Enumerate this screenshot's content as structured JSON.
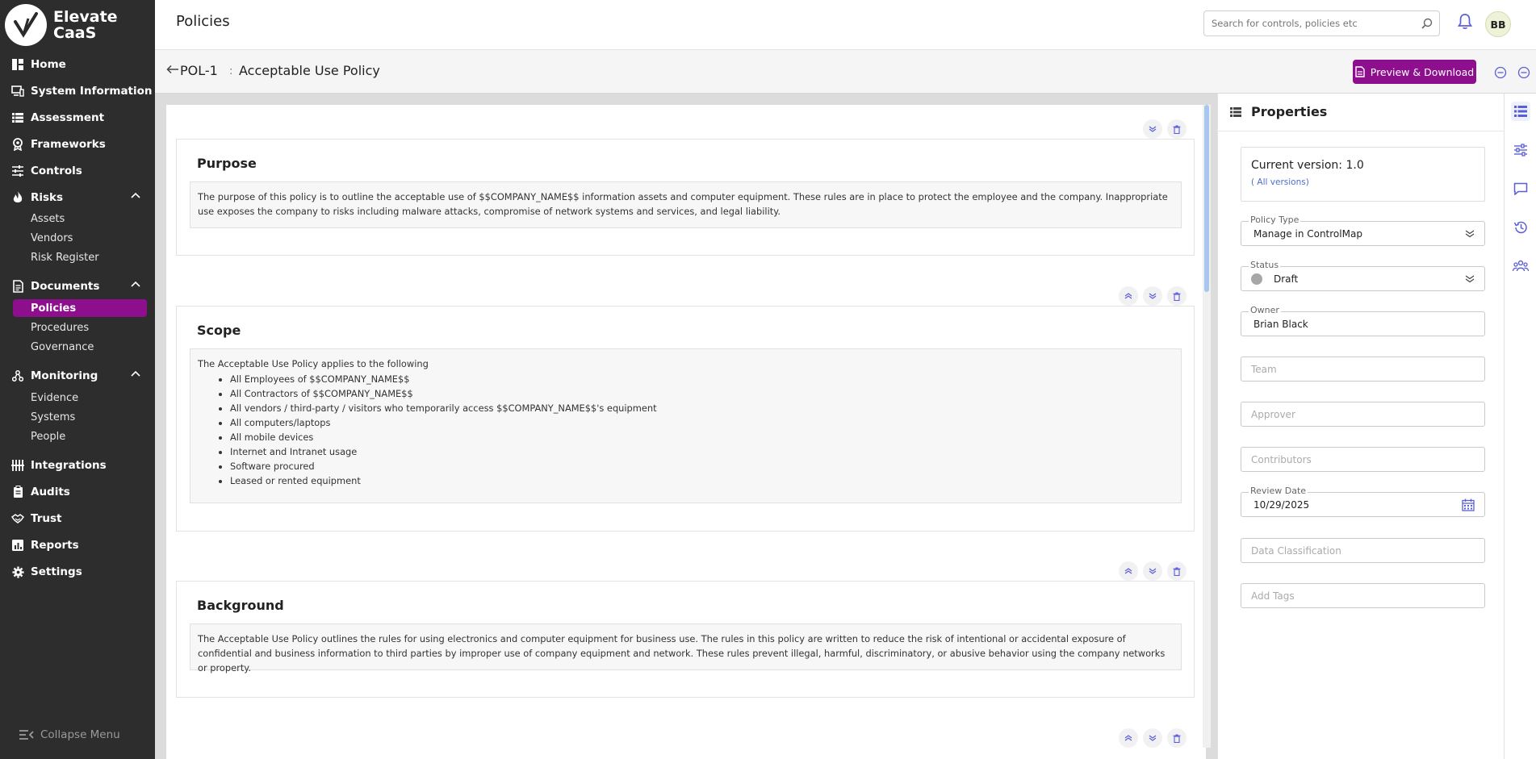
{
  "brand": {
    "line1": "Elevate",
    "line2": "CaaS"
  },
  "sidebar": {
    "items": [
      {
        "label": "Home",
        "icon": "dashboard-icon"
      },
      {
        "label": "System Information",
        "icon": "monitor-icon"
      },
      {
        "label": "Assessment",
        "icon": "list-icon"
      },
      {
        "label": "Frameworks",
        "icon": "badge-icon"
      },
      {
        "label": "Controls",
        "icon": "sliders-icon"
      },
      {
        "label": "Risks",
        "icon": "flame-icon",
        "expanded": true,
        "children": [
          "Assets",
          "Vendors",
          "Risk Register"
        ]
      },
      {
        "label": "Documents",
        "icon": "document-icon",
        "expanded": true,
        "children": [
          "Policies",
          "Procedures",
          "Governance"
        ],
        "active_child": "Policies"
      },
      {
        "label": "Monitoring",
        "icon": "nodes-icon",
        "expanded": true,
        "children": [
          "Evidence",
          "Systems",
          "People"
        ]
      },
      {
        "label": "Integrations",
        "icon": "integrations-icon"
      },
      {
        "label": "Audits",
        "icon": "clipboard-icon"
      },
      {
        "label": "Trust",
        "icon": "handshake-icon"
      },
      {
        "label": "Reports",
        "icon": "report-icon"
      },
      {
        "label": "Settings",
        "icon": "gear-icon"
      }
    ],
    "collapse_label": "Collapse Menu"
  },
  "topbar": {
    "title": "Policies",
    "search_placeholder": "Search for controls, policies etc",
    "avatar_initials": "BB"
  },
  "policy": {
    "id": "POL-1",
    "separator": ":",
    "name": "Acceptable Use Policy",
    "preview_label": "Preview & Download"
  },
  "sections": [
    {
      "title": "Purpose",
      "body": "The purpose of this policy is to outline the acceptable use of $$COMPANY_NAME$$ information assets and computer equipment. These rules are in place to protect the employee and the company. Inappropriate use exposes the company to risks including malware attacks, compromise of network systems and services, and legal liability."
    },
    {
      "title": "Scope",
      "intro": "The Acceptable Use Policy applies to the following",
      "bullets": [
        "All Employees of $$COMPANY_NAME$$",
        "All Contractors of $$COMPANY_NAME$$",
        "All vendors / third-party / visitors who temporarily access $$COMPANY_NAME$$'s equipment",
        "All computers/laptops",
        "All mobile devices",
        "Internet and Intranet usage",
        "Software procured",
        "Leased or rented equipment"
      ]
    },
    {
      "title": "Background",
      "body": "The Acceptable Use Policy outlines the rules for using electronics and computer equipment for business use. The rules in this policy are written to reduce the risk of intentional or accidental exposure of confidential and business information to third parties by improper use of company equipment and network. These rules prevent illegal, harmful, discriminatory, or abusive behavior using the company networks or property."
    }
  ],
  "properties": {
    "title": "Properties",
    "current_version_label": "Current version: 1.0",
    "all_versions_link": "( All versions)",
    "policy_type": {
      "label": "Policy Type",
      "value": "Manage in ControlMap"
    },
    "status": {
      "label": "Status",
      "value": "Draft"
    },
    "owner": {
      "label": "Owner",
      "value": "Brian Black"
    },
    "team": {
      "placeholder": "Team"
    },
    "approver": {
      "placeholder": "Approver"
    },
    "contributors": {
      "placeholder": "Contributors"
    },
    "review_date": {
      "label": "Review Date",
      "value": "10/29/2025"
    },
    "data_classification": {
      "placeholder": "Data Classification"
    },
    "tags": {
      "placeholder": "Add Tags"
    }
  },
  "colors": {
    "sidebar_bg": "#2d2d2d",
    "accent": "#8d0f8d",
    "link": "#4b6cd6",
    "icon_blue": "#5b5fd6"
  }
}
